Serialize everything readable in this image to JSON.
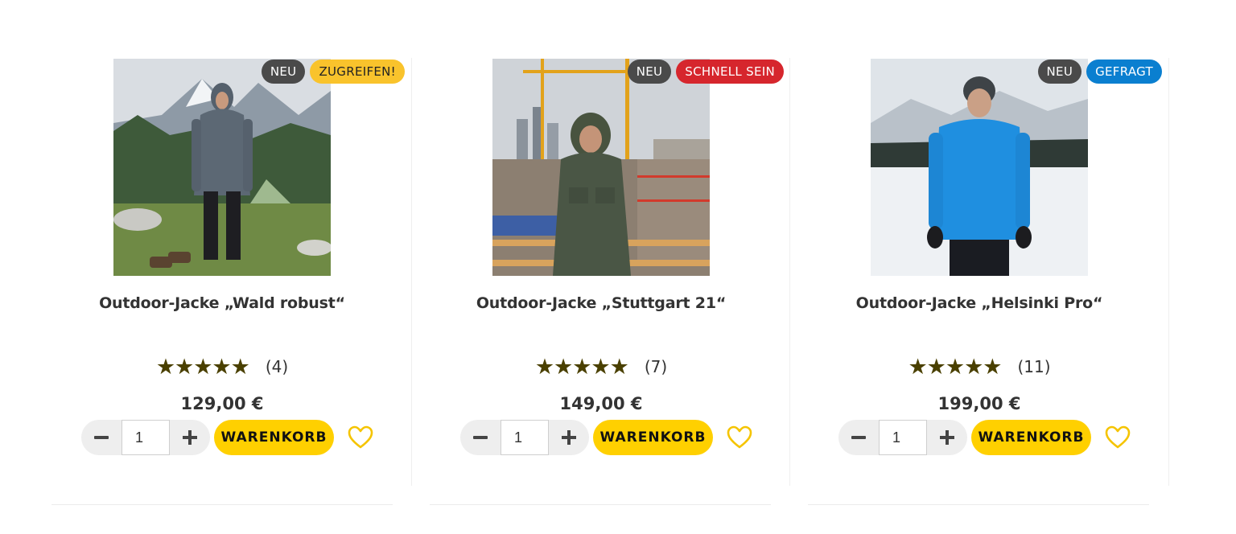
{
  "colors": {
    "accent": "#ffd000",
    "star": "#4a4000",
    "badge_dark": "#4a4a4a",
    "badge_yellow": "#f9c32c",
    "badge_red": "#d6262d",
    "badge_blue": "#0a7fd0"
  },
  "products": [
    {
      "title": "Outdoor-Jacke „Wald robust“",
      "image_icon": "product-photo-green-mountains",
      "badges": [
        {
          "label": "Neu",
          "color": "dark"
        },
        {
          "label": "Zugreifen!",
          "color": "yellow"
        }
      ],
      "stars": "★★★★★",
      "rating_count": "(4)",
      "price": "129,00 €",
      "quantity": "1",
      "cart_label": "WARENKORB",
      "wishlist_icon": "heart-outline-icon"
    },
    {
      "title": "Outdoor-Jacke „Stuttgart 21“",
      "image_icon": "product-photo-construction-site",
      "badges": [
        {
          "label": "Neu",
          "color": "dark"
        },
        {
          "label": "Schnell sein",
          "color": "red"
        }
      ],
      "stars": "★★★★★",
      "rating_count": "(7)",
      "price": "149,00 €",
      "quantity": "1",
      "cart_label": "WARENKORB",
      "wishlist_icon": "heart-outline-icon"
    },
    {
      "title": "Outdoor-Jacke „Helsinki Pro“",
      "image_icon": "product-photo-snow-landscape",
      "badges": [
        {
          "label": "Neu",
          "color": "dark"
        },
        {
          "label": "Gefragt",
          "color": "blue"
        }
      ],
      "stars": "★★★★★",
      "rating_count": "(11)",
      "price": "199,00 €",
      "quantity": "1",
      "cart_label": "WARENKORB",
      "wishlist_icon": "heart-outline-icon"
    }
  ]
}
